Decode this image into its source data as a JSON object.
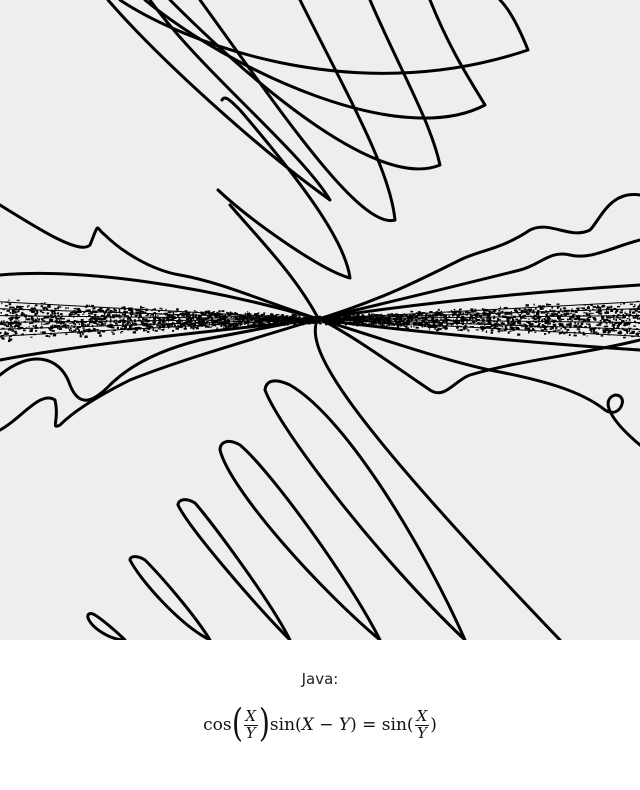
{
  "plot": {
    "background": "#eeeeee",
    "stroke": "#000000"
  },
  "caption": {
    "label": "Java:",
    "equation": {
      "cos": "cos",
      "sin1": "sin",
      "open": "(",
      "x1": "X",
      "minus": " − ",
      "y1": "Y",
      "close": ")",
      "equals": " = ",
      "sin2": "sin",
      "frac_num": "X",
      "frac_den": "Y"
    }
  }
}
